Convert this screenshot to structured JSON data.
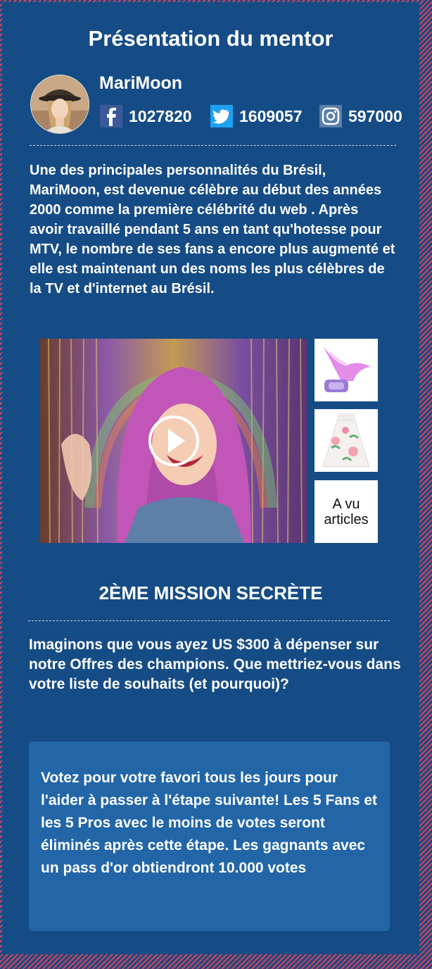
{
  "header": {
    "title": "Présentation du mentor"
  },
  "mentor": {
    "name": "MariMoon",
    "facebook": {
      "icon": "facebook-icon",
      "count": "1027820"
    },
    "twitter": {
      "icon": "twitter-icon",
      "count": "1609057"
    },
    "instagram": {
      "icon": "instagram-icon",
      "count": "597000"
    },
    "bio": "Une des principales personnalités du Brésil, MariMoon, est devenue célèbre au début des années 2000 comme la première célébrité du web . Après avoir travaillé pendant 5 ans en tant qu'hotesse pour MTV, le nombre de ses fans a encore plus augmenté et elle est maintenant un des noms les plus célèbres de la TV et d'internet au Brésil."
  },
  "media": {
    "play_icon": "play-icon",
    "more_articles_label": "A vu articles"
  },
  "mission": {
    "title": "2ÈME MISSION SECRÈTE",
    "question": "Imaginons que vous ayez US $300 à dépenser sur notre Offres des champions. Que mettriez-vous dans votre liste de souhaits (et pourquoi)?"
  },
  "vote": {
    "text": "Votez pour votre favori tous les jours pour l'aider à passer à l'étape suivante! Les 5 Fans et les 5 Pros avec le moins de votes seront éliminés après cette étape. Les gagnants avec un pass d'or obtiendront 10.000 votes"
  },
  "colors": {
    "panel": "#164c86",
    "vote_box": "#2266a8",
    "border_stripe": "#d0435f",
    "facebook": "#3b5998",
    "twitter": "#1da1f2"
  }
}
